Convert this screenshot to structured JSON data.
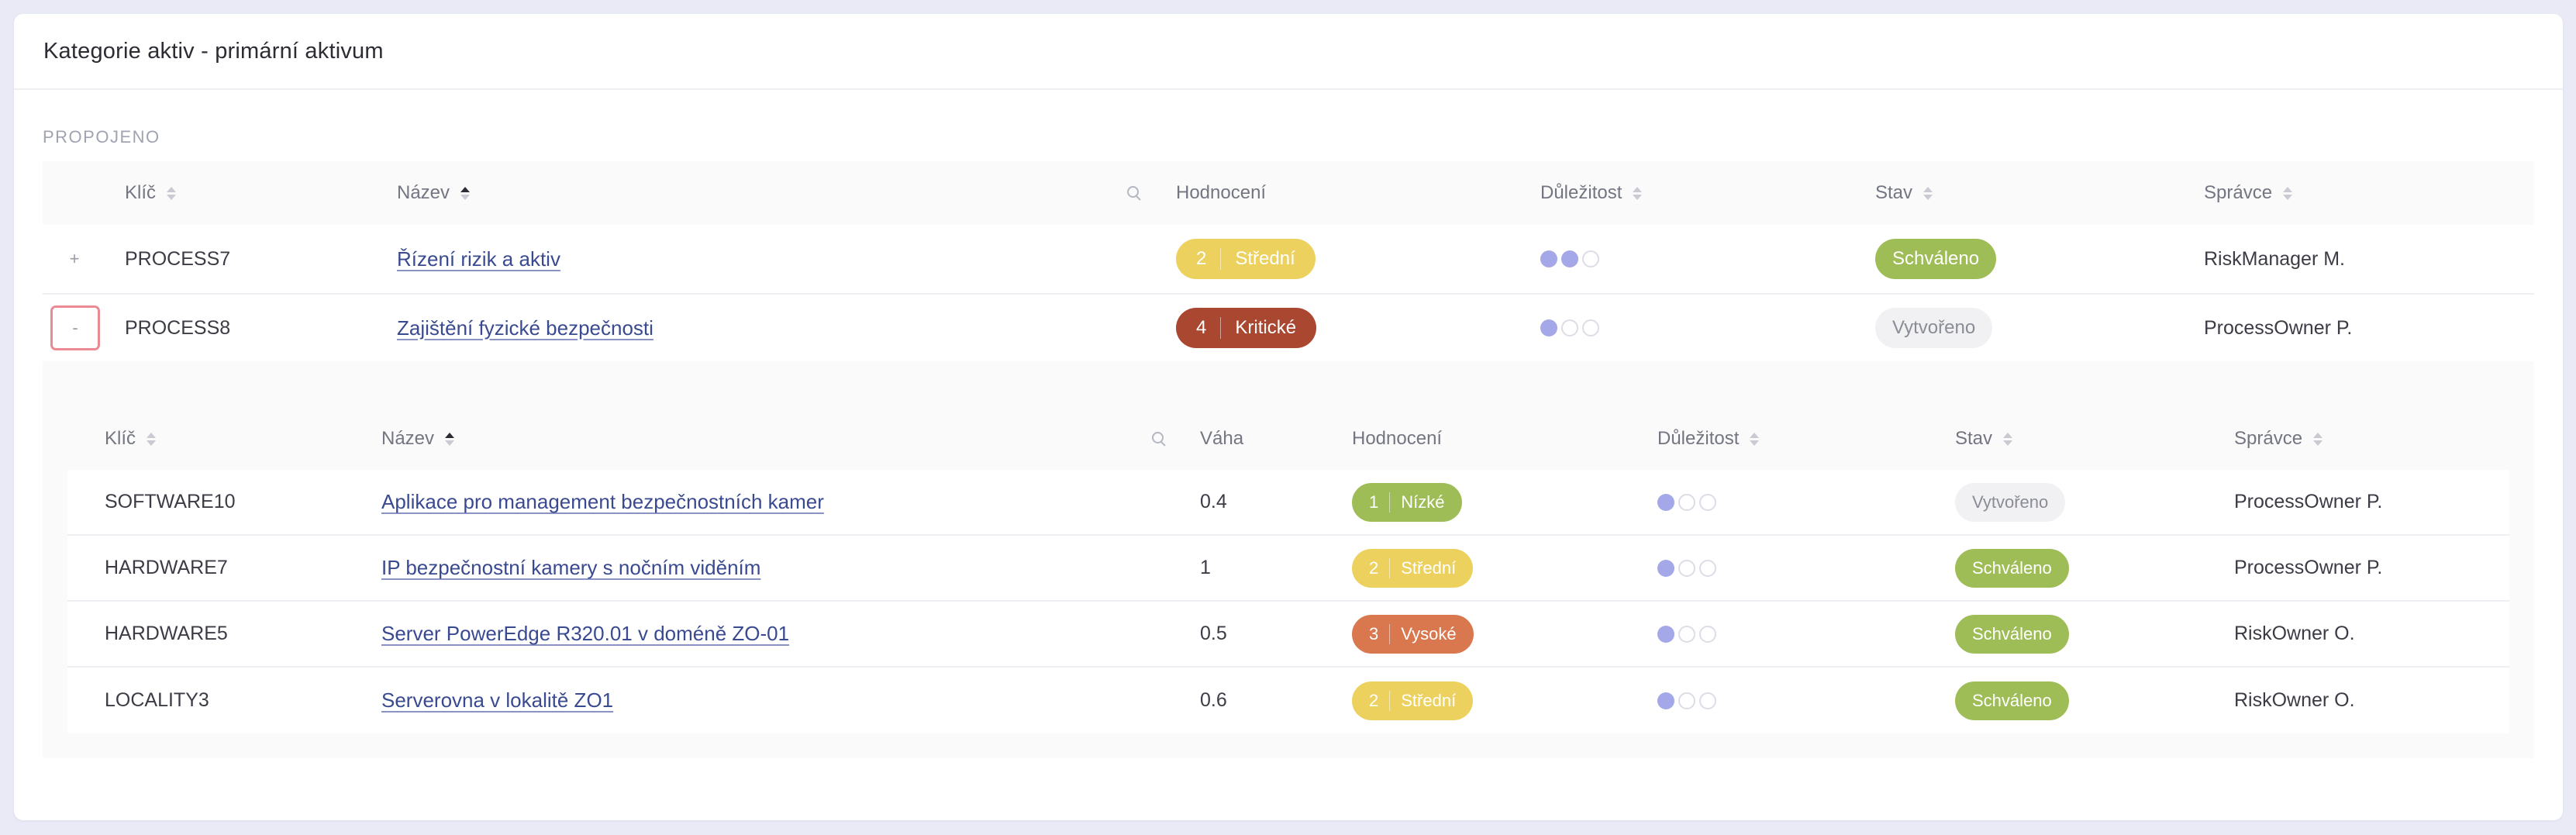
{
  "card": {
    "title": "Kategorie aktiv - primární aktivum"
  },
  "section": {
    "label": "PROPOJENO"
  },
  "colors": {
    "level_2": "#ecd15f",
    "level_4": "#a94731",
    "level_1": "#9fbd56",
    "level_3": "#d9774f",
    "status_approved": "#9fbd56",
    "status_created_bg": "#f1f1f3",
    "status_created_text": "#8a8c96",
    "dot_on": "#a4a8e8"
  },
  "outer": {
    "headers": {
      "key": "Klíč",
      "name": "Název",
      "rating": "Hodnocení",
      "importance": "Důležitost",
      "state": "Stav",
      "owner": "Správce"
    },
    "rows": [
      {
        "expander": "+",
        "key": "PROCESS7",
        "name": "Řízení rizik a aktiv",
        "rating_num": "2",
        "rating_text": "Střední",
        "importance": 2,
        "state": "Schváleno",
        "owner": "RiskManager M."
      },
      {
        "expander": "-",
        "key": "PROCESS8",
        "name": "Zajištění fyzické bezpečnosti",
        "rating_num": "4",
        "rating_text": "Kritické",
        "importance": 1,
        "state": "Vytvořeno",
        "owner": "ProcessOwner P."
      }
    ]
  },
  "inner": {
    "headers": {
      "key": "Klíč",
      "name": "Název",
      "weight": "Váha",
      "rating": "Hodnocení",
      "importance": "Důležitost",
      "state": "Stav",
      "owner": "Správce"
    },
    "rows": [
      {
        "key": "SOFTWARE10",
        "name": "Aplikace pro management bezpečnostních kamer",
        "weight": "0.4",
        "rating_num": "1",
        "rating_text": "Nízké",
        "importance": 1,
        "state": "Vytvořeno",
        "owner": "ProcessOwner P."
      },
      {
        "key": "HARDWARE7",
        "name": "IP bezpečnostní kamery s nočním viděním",
        "weight": "1",
        "rating_num": "2",
        "rating_text": "Střední",
        "importance": 1,
        "state": "Schváleno",
        "owner": "ProcessOwner P."
      },
      {
        "key": "HARDWARE5",
        "name": "Server PowerEdge R320.01 v doméně ZO-01",
        "weight": "0.5",
        "rating_num": "3",
        "rating_text": "Vysoké",
        "importance": 1,
        "state": "Schváleno",
        "owner": "RiskOwner O."
      },
      {
        "key": "LOCALITY3",
        "name": "Serverovna v lokalitě ZO1",
        "weight": "0.6",
        "rating_num": "2",
        "rating_text": "Střední",
        "importance": 1,
        "state": "Schváleno",
        "owner": "RiskOwner O."
      }
    ]
  }
}
